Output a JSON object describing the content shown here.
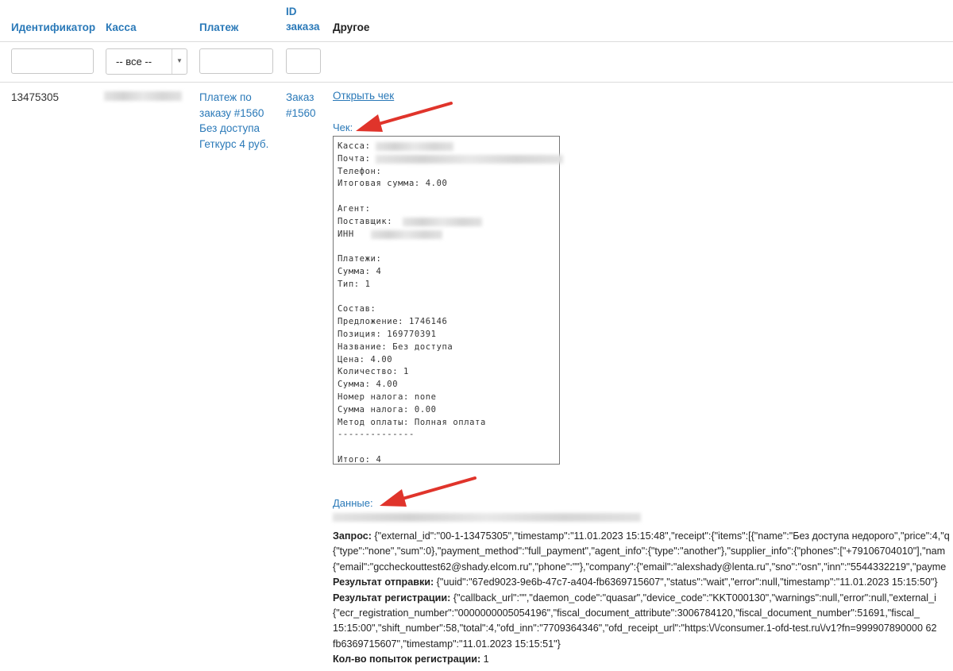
{
  "table": {
    "headers": {
      "id": "Идентификатор",
      "kassa": "Касса",
      "payment": "Платеж",
      "order_id_1": "ID",
      "order_id_2": "заказа",
      "other": "Другое"
    },
    "filters": {
      "kassa_select_value": "-- все --"
    },
    "row": {
      "id": "13475305",
      "payment_lines": [
        "Платеж по",
        "заказу #1560",
        "Без доступа",
        "Геткурс 4 руб."
      ],
      "order_lines": [
        "Заказ",
        "#1560"
      ],
      "open_receipt": "Открыть чек",
      "receipt_label": "Чек:",
      "receipt_lines": [
        "Касса:",
        "Почта:",
        "Телефон:",
        "Итоговая сумма: 4.00",
        "",
        "Агент:",
        "Поставщик:",
        "ИНН",
        "",
        "Платежи:",
        "Сумма: 4",
        "Тип: 1",
        "",
        "Состав:",
        "Предложение: 1746146",
        "Позиция: 169770391",
        "Название: Без доступа",
        "Цена: 4.00",
        "Количество: 1",
        "Сумма: 4.00",
        "Номер налога: none",
        "Сумма налога: 0.00",
        "Метод оплаты: Полная оплата",
        "--------------",
        "",
        "Итого: 4"
      ],
      "data_label": "Данные:",
      "data": {
        "request_label": "Запрос:",
        "request_l1": " {\"external_id\":\"00-1-13475305\",\"timestamp\":\"11.01.2023 15:15:48\",\"receipt\":{\"items\":[{\"name\":\"Без доступа недорого\",\"price\":4,\"q",
        "request_l2": "{\"type\":\"none\",\"sum\":0},\"payment_method\":\"full_payment\",\"agent_info\":{\"type\":\"another\"},\"supplier_info\":{\"phones\":[\"+79106704010\"],\"nam",
        "request_l3": "{\"email\":\"gccheckouttest62@shady.elcom.ru\",\"phone\":\"\"},\"company\":{\"email\":\"alexshady@lenta.ru\",\"sno\":\"osn\",\"inn\":\"5544332219\",\"payme",
        "send_label": "Результат отправки:",
        "send_value": " {\"uuid\":\"67ed9023-9e6b-47c7-a404-fb6369715607\",\"status\":\"wait\",\"error\":null,\"timestamp\":\"11.01.2023 15:15:50\"}",
        "reg_label": "Результат регистрации:",
        "reg_l1": " {\"callback_url\":\"\",\"daemon_code\":\"quasar\",\"device_code\":\"KKT000130\",\"warnings\":null,\"error\":null,\"external_i",
        "reg_l2": "{\"ecr_registration_number\":\"0000000005054196\",\"fiscal_document_attribute\":3006784120,\"fiscal_document_number\":51691,\"fiscal_",
        "reg_l3": "15:15:00\",\"shift_number\":58,\"total\":4,\"ofd_inn\":\"7709364346\",\"ofd_receipt_url\":\"https:\\/\\/consumer.1-ofd-test.ru\\/v1?fn=999907890000 62",
        "reg_l4": "fb6369715607\",\"timestamp\":\"11.01.2023 15:15:51\"}",
        "attempts_label": "Кол-во попыток регистрации:",
        "attempts_value": " 1"
      }
    }
  },
  "colors": {
    "link": "#2a79b8",
    "arrow": "#e0342b",
    "border": "#dcdcdc"
  }
}
